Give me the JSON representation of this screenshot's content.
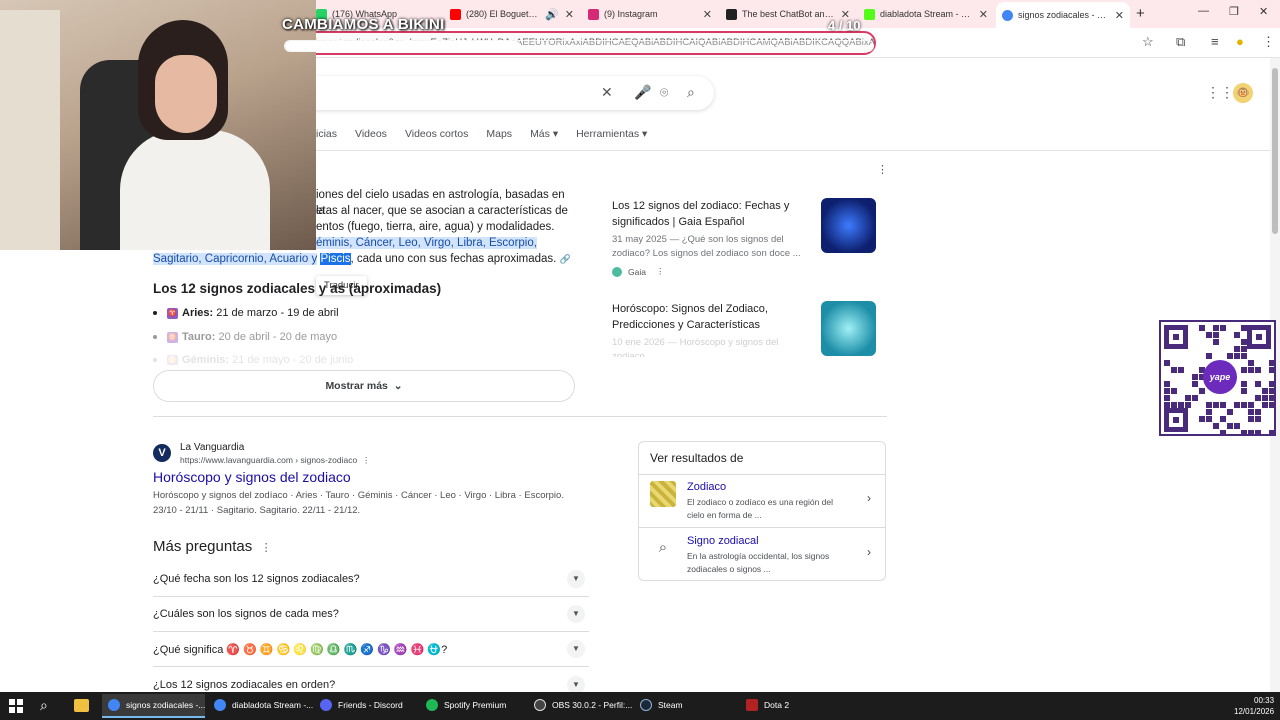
{
  "browser": {
    "tabs": [
      {
        "title": "(176) WhatsApp",
        "color": "#25d366"
      },
      {
        "title": "(280) El Bogueto , Yer",
        "color": "#ff0000",
        "extra": "🔊"
      },
      {
        "title": "(9) Instagram",
        "color": "#d62976"
      },
      {
        "title": "The best ChatBot and W",
        "color": "#222222"
      },
      {
        "title": "diabladota Stream - Wat",
        "color": "#53fc18"
      },
      {
        "title": "signos zodiacales - Busca",
        "color": "#4285f4"
      }
    ],
    "address": "oq=signos+zodiacales&gs_lcrp=EgZjaHJvbWUyDAgAEEUYORixAxiABDIHCAEQABiABDIHCAIQABiABDIHCAMQABiABDIKCAQQABixAxiABDIHCAUQABiABDIHCAYQABiABDIHCA",
    "new_tab": "+",
    "window_controls": {
      "minimize": "—",
      "restore": "❐",
      "close": "✕"
    }
  },
  "overlay": {
    "title": "CAMBIAMOS A BIKINI",
    "count": "4 / 10",
    "progress": 0.4
  },
  "qr": {
    "logo_text": "yape"
  },
  "google": {
    "tabs": [
      "icias",
      "Videos",
      "Videos cortos",
      "Maps",
      "Más ▾",
      "Herramientas ▾"
    ],
    "snippet_lines": [
      "iones del cielo usadas en astrología, basadas en la",
      "etas al nacer, que se asocian a características de",
      "entos (fuego, tierra, aire, agua) y modalidades."
    ],
    "snippet_hl": "éminis, Cáncer, Leo, Virgo, Libra, Escorpio,",
    "snippet_hl2": "Sagitario, Capricornio, Acuario y",
    "snippet_hl3": "Piscis",
    "snippet_tail": ", cada uno con sus fechas aproximadas.",
    "tooltip": "Traducir",
    "section_title": "Los 12 signos zodiacales y        as (aproximadas)",
    "bullets": [
      {
        "sign": "♈",
        "name": "Aries:",
        "dates": "21 de marzo - 19 de abril"
      },
      {
        "sign": "♉",
        "name": "Tauro:",
        "dates": "20 de abril - 20 de mayo"
      },
      {
        "sign": "♊",
        "name": "Géminis:",
        "dates": "21 de mayo - 20 de junio"
      }
    ],
    "show_more": "Mostrar más",
    "side_cards": [
      {
        "title": "Los 12 signos del zodiaco: Fechas y significados | Gaia Español",
        "snippet": "31 may 2025 — ¿Qué son los signos del zodiaco? Los signos del zodiaco son doce ...",
        "source": "Gaia",
        "thumb_color": "#1b3aa8"
      },
      {
        "title": "Horóscopo: Signos del Zodiaco, Predicciones y Características",
        "snippet": "10 ene 2026 — Horóscopo y signos del zodiaco",
        "source": "",
        "thumb_color": "#2bb3c7"
      }
    ],
    "result": {
      "logo": "V",
      "site": "La Vanguardia",
      "url": "https://www.lavanguardia.com › signos-zodiaco",
      "title": "Horóscopo y signos del zodiaco",
      "snippet": "Horóscopo y signos del zodíaco · Aries · Tauro · Géminis · Cáncer · Leo · Virgo · Libra · Escorpio. 23/10 - 21/11 · Sagitario. Sagitario. 22/11 - 21/12."
    },
    "more_questions": {
      "title": "Más preguntas",
      "items": [
        "¿Qué fecha son los 12 signos zodiacales?",
        "¿Cuáles son los signos de cada mes?",
        "¿Qué significa ♈ ♉ ♊ ♋ ♌ ♍ ♎ ♏ ♐ ♑ ♒ ♓ ⛎?",
        "¿Los 12 signos zodiacales en orden?"
      ]
    },
    "see_results": {
      "title": "Ver resultados de",
      "items": [
        {
          "title": "Zodiaco",
          "desc": "El zodiaco o zodíaco es una región del cielo en forma de ..."
        },
        {
          "title": "Signo zodiacal",
          "desc": "En la astrología occidental, los signos zodiacales o signos ..."
        }
      ]
    }
  },
  "taskbar": {
    "apps": [
      {
        "label": "signos zodiacales -...",
        "color": "#4285f4"
      },
      {
        "label": "diabladota Stream -...",
        "color": "#4285f4"
      },
      {
        "label": "Friends - Discord",
        "color": "#5865f2"
      },
      {
        "label": "Spotify Premium",
        "color": "#1db954"
      },
      {
        "label": "OBS 30.0.2 - Perfil:...",
        "color": "#444444"
      },
      {
        "label": "Steam",
        "color": "#1b2838"
      },
      {
        "label": "Dota 2",
        "color": "#b22222"
      }
    ],
    "time": "00:33",
    "date": "12/01/2026"
  }
}
